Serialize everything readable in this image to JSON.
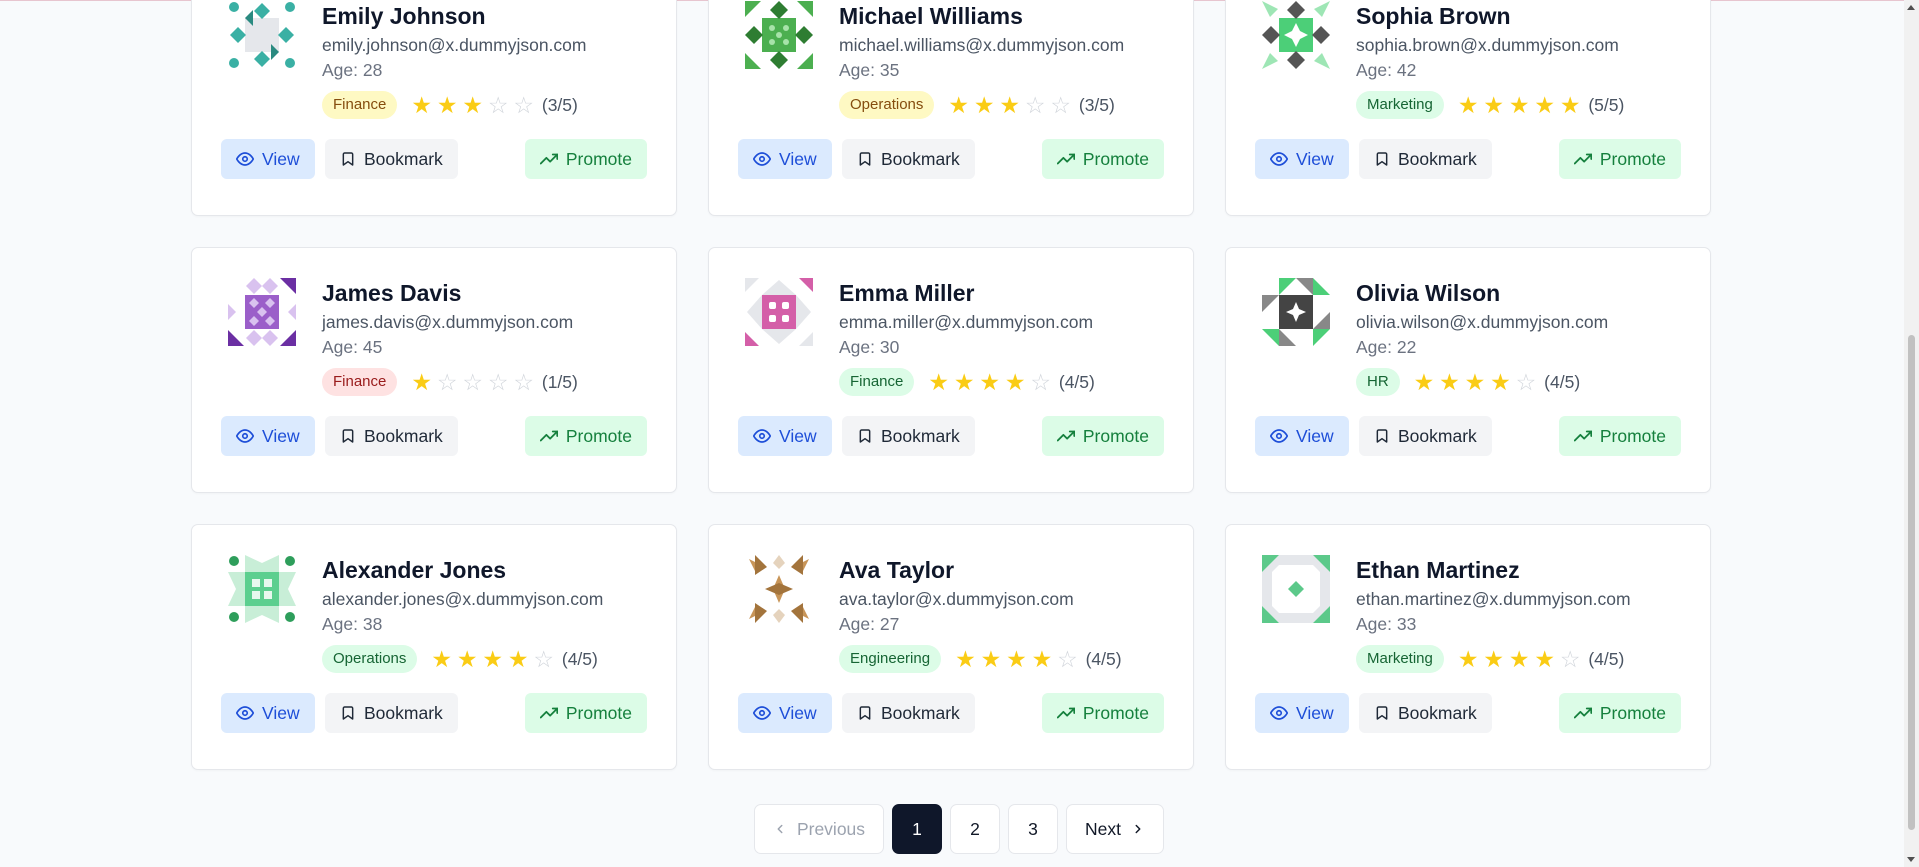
{
  "users": [
    {
      "name": "Emily Johnson",
      "email": "emily.johnson@x.dummyjson.com",
      "age": "Age: 28",
      "department": "Finance",
      "rating": 3,
      "rating_text": "(3/5)",
      "badge_bg": "#fef9c3",
      "badge_fg": "#854d0e",
      "avatar_color": "#3ab0a4",
      "avatar_style": "teal-diamonds"
    },
    {
      "name": "Michael Williams",
      "email": "michael.williams@x.dummyjson.com",
      "age": "Age: 35",
      "department": "Operations",
      "rating": 3,
      "rating_text": "(3/5)",
      "badge_bg": "#fef9c3",
      "badge_fg": "#854d0e",
      "avatar_color": "#4caf50",
      "avatar_style": "green-diamonds"
    },
    {
      "name": "Sophia Brown",
      "email": "sophia.brown@x.dummyjson.com",
      "age": "Age: 42",
      "department": "Marketing",
      "rating": 5,
      "rating_text": "(5/5)",
      "badge_bg": "#dcfce7",
      "badge_fg": "#166534",
      "avatar_color": "#4ccf78",
      "avatar_style": "dark-green-star"
    },
    {
      "name": "James Davis",
      "email": "james.davis@x.dummyjson.com",
      "age": "Age: 45",
      "department": "Finance",
      "rating": 1,
      "rating_text": "(1/5)",
      "badge_bg": "#fee2e2",
      "badge_fg": "#991b1b",
      "avatar_color": "#9b5fc9",
      "avatar_style": "purple-grid"
    },
    {
      "name": "Emma Miller",
      "email": "emma.miller@x.dummyjson.com",
      "age": "Age: 30",
      "department": "Finance",
      "rating": 4,
      "rating_text": "(4/5)",
      "badge_bg": "#dcfce7",
      "badge_fg": "#166534",
      "avatar_color": "#d45fa8",
      "avatar_style": "pink-dice"
    },
    {
      "name": "Olivia Wilson",
      "email": "olivia.wilson@x.dummyjson.com",
      "age": "Age: 22",
      "department": "HR",
      "rating": 4,
      "rating_text": "(4/5)",
      "badge_bg": "#dcfce7",
      "badge_fg": "#166534",
      "avatar_color": "#4ccf78",
      "avatar_style": "dark-green-pinwheel"
    },
    {
      "name": "Alexander Jones",
      "email": "alexander.jones@x.dummyjson.com",
      "age": "Age: 38",
      "department": "Operations",
      "rating": 4,
      "rating_text": "(4/5)",
      "badge_bg": "#dcfce7",
      "badge_fg": "#166534",
      "avatar_color": "#2e9e5b",
      "avatar_style": "green-window"
    },
    {
      "name": "Ava Taylor",
      "email": "ava.taylor@x.dummyjson.com",
      "age": "Age: 27",
      "department": "Engineering",
      "rating": 4,
      "rating_text": "(4/5)",
      "badge_bg": "#dcfce7",
      "badge_fg": "#166534",
      "avatar_color": "#c89558",
      "avatar_style": "tan-pinwheels"
    },
    {
      "name": "Ethan Martinez",
      "email": "ethan.martinez@x.dummyjson.com",
      "age": "Age: 33",
      "department": "Marketing",
      "rating": 4,
      "rating_text": "(4/5)",
      "badge_bg": "#dcfce7",
      "badge_fg": "#166534",
      "avatar_color": "#5cc98a",
      "avatar_style": "green-octagon"
    }
  ],
  "actions": {
    "view": "View",
    "bookmark": "Bookmark",
    "promote": "Promote"
  },
  "icons": {
    "view": "eye-icon",
    "bookmark": "bookmark-icon",
    "promote": "trending-up-icon",
    "star": "star-icon"
  },
  "pagination": {
    "previous": "Previous",
    "pages": [
      "1",
      "2",
      "3"
    ],
    "current": "1",
    "next": "Next"
  }
}
